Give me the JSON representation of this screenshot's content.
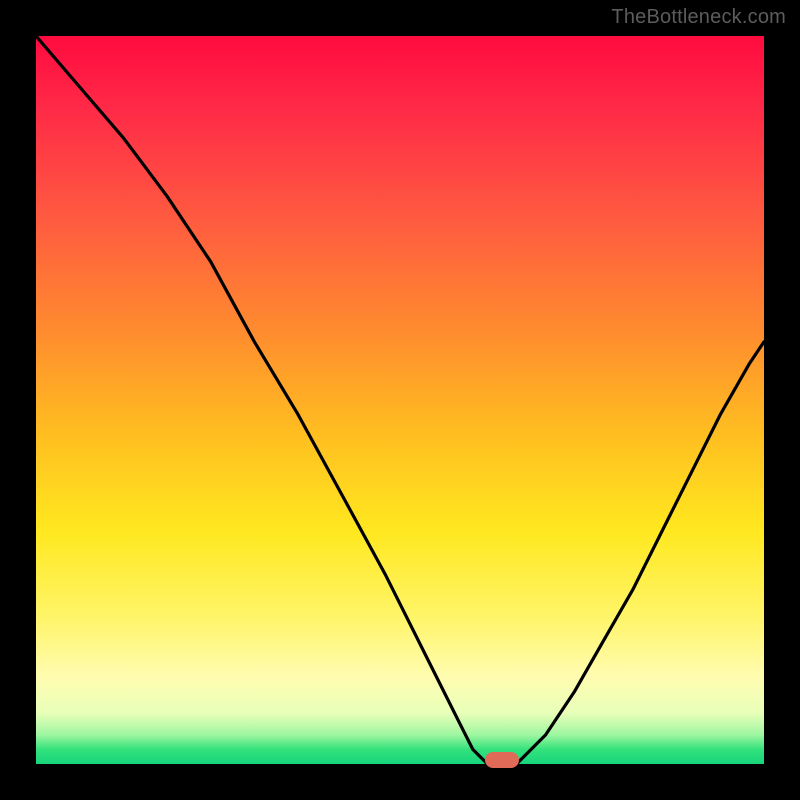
{
  "watermark": "TheBottleneck.com",
  "colors": {
    "frame": "#000000",
    "gradient_top": "#ff0b3f",
    "gradient_mid": "#ffe81f",
    "gradient_bottom": "#16d57d",
    "curve": "#000000",
    "marker": "#e06a58"
  },
  "chart_data": {
    "type": "line",
    "title": "",
    "xlabel": "",
    "ylabel": "",
    "xlim": [
      0,
      100
    ],
    "ylim": [
      0,
      100
    ],
    "series": [
      {
        "name": "bottleneck-curve",
        "x": [
          0,
          6,
          12,
          18,
          24,
          30,
          36,
          42,
          48,
          54,
          58,
          60,
          62,
          64,
          66,
          70,
          74,
          78,
          82,
          86,
          90,
          94,
          98,
          100
        ],
        "values": [
          100,
          93,
          86,
          78,
          69,
          58,
          48,
          37,
          26,
          14,
          6,
          2,
          0,
          0,
          0,
          4,
          10,
          17,
          24,
          32,
          40,
          48,
          55,
          58
        ]
      }
    ],
    "markers": [
      {
        "name": "optimal-point",
        "x": 64,
        "y": 0
      }
    ],
    "grid": false,
    "legend": false
  }
}
